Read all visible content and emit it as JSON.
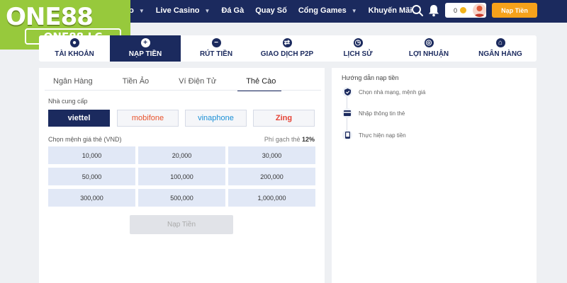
{
  "logo": {
    "main": "ONE88",
    "sub": "ONE88.LC"
  },
  "nav": {
    "items": [
      {
        "label": "ao",
        "has_dropdown": true
      },
      {
        "label": "Live Casino",
        "has_dropdown": true
      },
      {
        "label": "Đá Gà",
        "has_dropdown": false
      },
      {
        "label": "Quay Số",
        "has_dropdown": false
      },
      {
        "label": "Cổng Games",
        "has_dropdown": true
      },
      {
        "label": "Khuyến Mãi",
        "has_dropdown": false
      }
    ],
    "balance": "0",
    "topup_label": "Nạp Tiền"
  },
  "tabs": [
    {
      "label": "TÀI KHOẢN",
      "icon": "user-icon",
      "active": false
    },
    {
      "label": "NẠP TIỀN",
      "icon": "plus-icon",
      "active": true
    },
    {
      "label": "RÚT TIỀN",
      "icon": "minus-icon",
      "active": false
    },
    {
      "label": "GIAO DỊCH P2P",
      "icon": "exchange-icon",
      "active": false
    },
    {
      "label": "LỊCH SỬ",
      "icon": "clock-icon",
      "active": false
    },
    {
      "label": "LỢI NHUẬN",
      "icon": "globe-icon",
      "active": false
    },
    {
      "label": "NGÂN HÀNG",
      "icon": "bank-icon",
      "active": false
    }
  ],
  "deposit": {
    "subtabs": [
      {
        "label": "Ngân Hàng",
        "active": false
      },
      {
        "label": "Tiền Ảo",
        "active": false
      },
      {
        "label": "Ví Điện Tử",
        "active": false
      },
      {
        "label": "Thẻ Cào",
        "active": true
      }
    ],
    "provider_label": "Nhà cung cấp",
    "providers": [
      {
        "label": "viettel",
        "color": "#ffffff",
        "active": true
      },
      {
        "label": "mobifone",
        "color": "#e8522c",
        "active": false
      },
      {
        "label": "vinaphone",
        "color": "#1a8fd6",
        "active": false
      },
      {
        "label": "Zing",
        "color": "#e54235",
        "active": false
      }
    ],
    "denom_label": "Chọn mệnh giá thẻ (VND)",
    "fee_label": "Phí gạch thẻ",
    "fee_value": "12%",
    "denominations": [
      "10,000",
      "20,000",
      "30,000",
      "50,000",
      "100,000",
      "200,000",
      "300,000",
      "500,000",
      "1,000,000"
    ],
    "submit_label": "Nạp Tiền"
  },
  "guide": {
    "title": "Hướng dẫn nạp tiền",
    "steps": [
      {
        "label": "Chọn nhà mạng, mệnh giá",
        "icon": "shield-check-icon"
      },
      {
        "label": "Nhập thông tin thẻ",
        "icon": "card-icon"
      },
      {
        "label": "Thực hiện nạp tiền",
        "icon": "phone-icon"
      }
    ]
  },
  "colors": {
    "navy": "#1b2a5e",
    "brand_green": "#97c93c",
    "accent_orange": "#f7a21b"
  }
}
